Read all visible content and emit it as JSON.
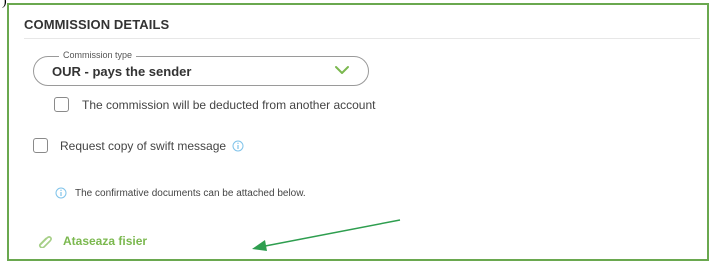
{
  "corner_mark": ").",
  "section": {
    "title": "COMMISSION DETAILS"
  },
  "commission_type": {
    "label": "Commission type",
    "selected": "OUR - pays the sender"
  },
  "checkboxes": {
    "deduct_other_account": {
      "label": "The commission will be deducted from another account",
      "checked": false
    },
    "swift_copy": {
      "label": "Request copy of swift message",
      "checked": false
    }
  },
  "note": {
    "text": "The confirmative documents can be attached below."
  },
  "attach": {
    "label": "Ataseaza fisier"
  },
  "icons": {
    "select_chevron": "chevron-down-icon",
    "swift_info": "info-icon",
    "note_info": "info-icon",
    "attach": "paperclip-icon",
    "annotation": "arrow-annotation"
  },
  "colors": {
    "frame": "#6aa84f",
    "accent_green": "#7bb84f",
    "info_blue": "#7fc3ea",
    "annotation_arrow": "#2e9e4f"
  }
}
